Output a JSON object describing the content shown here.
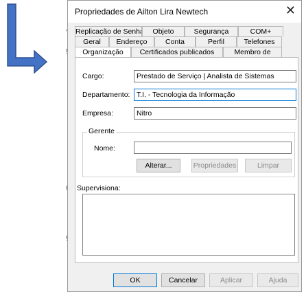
{
  "colors": {
    "arrow": "#4472c4",
    "arrow_border": "#2f528f",
    "dialog_bg": "#f0f0f0",
    "panel_bg": "#ffffff",
    "focus": "#0078d7"
  },
  "dialog": {
    "title": "Propriedades de Ailton Lira Newtech",
    "close_glyph": "✕"
  },
  "tabs": {
    "row1": [
      "Replicação de Senha",
      "Objeto",
      "Segurança",
      "COM+"
    ],
    "row2": [
      "Geral",
      "Endereço",
      "Conta",
      "Perfil",
      "Telefones"
    ],
    "row3": [
      "Organização",
      "Certificados publicados",
      "Membro de"
    ],
    "active": "Organização"
  },
  "form": {
    "cargo_label": "Cargo:",
    "cargo_value": "Prestado de Serviço | Analista de Sistemas",
    "departamento_label": "Departamento:",
    "departamento_value": "T.I. - Tecnologia da Informação",
    "empresa_label": "Empresa:",
    "empresa_value": "Nitro",
    "gerente_title": "Gerente",
    "nome_label": "Nome:",
    "nome_value": "",
    "alterar_button": "Alterar...",
    "propriedades_button": "Propriedades",
    "limpar_button": "Limpar",
    "supervisiona_label": "Supervisiona:"
  },
  "footer": {
    "ok": "OK",
    "cancelar": "Cancelar",
    "aplicar": "Aplicar",
    "ajuda": "Ajuda"
  }
}
